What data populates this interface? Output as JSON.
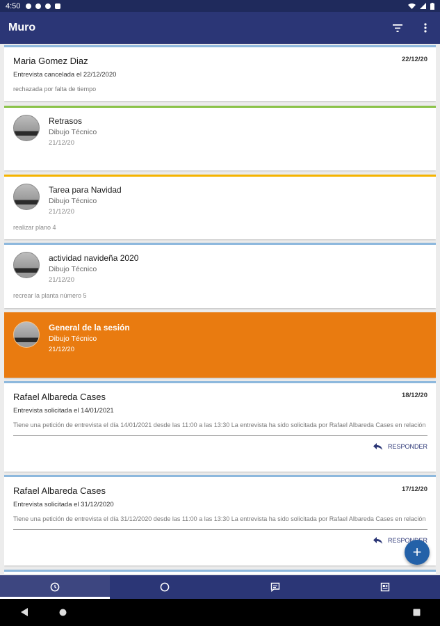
{
  "status_bar": {
    "time": "4:50"
  },
  "app_bar": {
    "title": "Muro",
    "filter_icon": "filter-icon",
    "more_icon": "more-vert-icon"
  },
  "cards": [
    {
      "name": "Maria Gomez Diaz",
      "date": "22/12/20",
      "subtitle": "Entrevista cancelada el 22/12/2020",
      "body": "rechazada por falta de tiempo"
    },
    {
      "title": "Retrasos",
      "subject": "Dibujo Técnico",
      "date": "21/12/20"
    },
    {
      "title": "Tarea para Navidad",
      "subject": "Dibujo Técnico",
      "date": "21/12/20",
      "note": "realizar plano 4"
    },
    {
      "title": "actividad navideña 2020",
      "subject": "Dibujo Técnico",
      "date": "21/12/20",
      "note": "recrear la planta número 5"
    },
    {
      "title": "General de la sesión",
      "subject": "Dibujo Técnico",
      "date": "21/12/20"
    },
    {
      "name": "Rafael Albareda Cases",
      "date": "18/12/20",
      "subtitle": "Entrevista solicitada el 14/01/2021",
      "body": "Tiene una petición de entrevista el día 14/01/2021 desde las 11:00 a las 13:30 La entrevista ha sido solicitada por Rafael Albareda Cases en relación",
      "reply": "RESPONDER"
    },
    {
      "name": "Rafael Albareda Cases",
      "date": "17/12/20",
      "subtitle": "Entrevista solicitada el 31/12/2020",
      "body": "Tiene una petición de entrevista el día 31/12/2020 desde las 11:00 a las 13:30 La entrevista ha sido solicitada por Rafael Albareda Cases en relación",
      "reply": "RESPONDER"
    }
  ],
  "fab": {
    "label": "+"
  },
  "bottom_tabs": [
    {
      "icon": "clock-icon",
      "active": true
    },
    {
      "icon": "circle-icon",
      "active": false
    },
    {
      "icon": "chat-icon",
      "active": false
    },
    {
      "icon": "news-icon",
      "active": false
    }
  ],
  "colors": {
    "primary": "#2b3676",
    "accent": "#e97b10",
    "fab": "#2361a8"
  }
}
